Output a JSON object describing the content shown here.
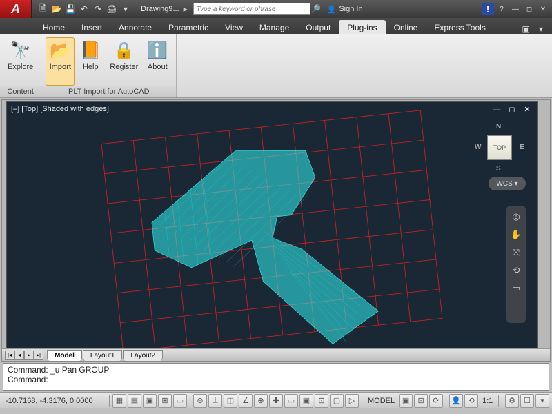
{
  "app": {
    "logo_letter": "A",
    "doc_title": "Drawing9..."
  },
  "search": {
    "placeholder": "Type a keyword or phrase"
  },
  "signin": {
    "label": "Sign In"
  },
  "tabs": {
    "items": [
      "Home",
      "Insert",
      "Annotate",
      "Parametric",
      "View",
      "Manage",
      "Output",
      "Plug-ins",
      "Online",
      "Express Tools"
    ],
    "active_index": 7
  },
  "ribbon": {
    "groups": [
      {
        "title": "Content",
        "buttons": [
          {
            "label": "Explore",
            "icon": "🔭"
          }
        ]
      },
      {
        "title": "PLT Import for AutoCAD",
        "buttons": [
          {
            "label": "Import",
            "icon": "📂",
            "active": true
          },
          {
            "label": "Help",
            "icon": "📙"
          },
          {
            "label": "Register",
            "icon": "🔒"
          },
          {
            "label": "About",
            "icon": "ℹ️"
          }
        ]
      }
    ]
  },
  "viewport": {
    "label": "[–] [Top] [Shaded with edges]",
    "viewcube_face": "TOP",
    "compass": {
      "n": "N",
      "e": "E",
      "s": "S",
      "w": "W"
    },
    "wcs": "WCS ▾"
  },
  "layout_tabs": {
    "items": [
      "Model",
      "Layout1",
      "Layout2"
    ],
    "active_index": 0
  },
  "command": {
    "line1": "Command: _u Pan GROUP",
    "line2": "Command:"
  },
  "status": {
    "coords": "-10.7168, -4.3176, 0.0000",
    "model": "MODEL",
    "scale": "1:1",
    "icons1": [
      "▦",
      "▤",
      "▣",
      "⊞",
      "▭"
    ],
    "icons2": [
      "⊙",
      "⟂",
      "◫",
      "∠",
      "⊕",
      "✚",
      "▭",
      "▣",
      "⊡",
      "▢",
      "▷"
    ],
    "icons3": [
      "▣",
      "⊡",
      "⟳"
    ],
    "icons4": [
      "👤",
      "⟲"
    ],
    "icons5": [
      "⚙",
      "☐",
      "▾"
    ]
  },
  "chart_data": {
    "type": "table",
    "title": "AutoCAD viewport showing imported 3D wireframe model (handheld tool) on planar red grid",
    "view": "Top, Shaded with edges",
    "grid": {
      "extent_approx_x": [
        -10,
        10
      ],
      "extent_approx_y": [
        -6,
        6
      ],
      "spacing": 1,
      "color": "#d02020"
    },
    "model_color": "#33f0f0",
    "cursor_coords": {
      "x": -10.7168,
      "y": -4.3176,
      "z": 0.0
    }
  }
}
